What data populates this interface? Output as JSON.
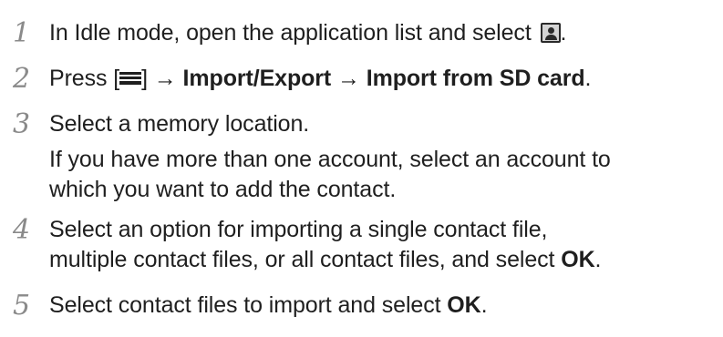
{
  "steps": [
    {
      "number": "1",
      "text_before_icon": "In Idle mode, open the application list and select ",
      "icon": "contacts-app-icon",
      "text_after_icon": "."
    },
    {
      "number": "2",
      "press": "Press [",
      "key_icon": "menu-key-icon",
      "after_key": "] → ",
      "path_1": "Import/Export",
      "arrow": " → ",
      "path_2": "Import from SD card",
      "end": "."
    },
    {
      "number": "3",
      "line_1": "Select a memory location.",
      "line_2": "If you have more than one account, select an account to",
      "line_3": "which you want to add the contact."
    },
    {
      "number": "4",
      "line_1": "Select an option for importing a single contact file,",
      "line_2_text": "multiple contact files, or all contact files, and select ",
      "line_2_bold": "OK",
      "line_2_end": "."
    },
    {
      "number": "5",
      "text": "Select contact files to import and select ",
      "bold": "OK",
      "end": "."
    }
  ]
}
